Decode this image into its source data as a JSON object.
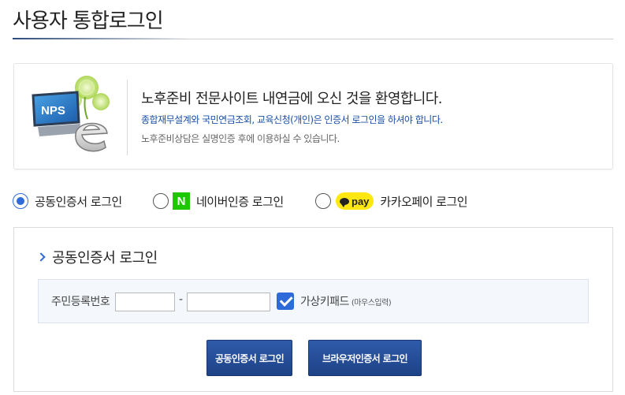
{
  "page": {
    "title": "사용자 통합로그인"
  },
  "welcome": {
    "logo_text": "NPS",
    "heading": "노후준비 전문사이트 내연금에 오신 것을 환영합니다.",
    "info": "종합재무설계와 국민연금조회, 교육신청(개인)은 인증서 로그인을 하셔야 합니다.",
    "note": "노후준비상담은 실명인증 후에 이용하실 수 있습니다."
  },
  "login_options": [
    {
      "label": "공동인증서 로그인",
      "selected": true
    },
    {
      "label": "네이버인증 로그인",
      "badge": "N",
      "selected": false
    },
    {
      "label": "카카오페이 로그인",
      "badge": "pay",
      "selected": false
    }
  ],
  "cert_login": {
    "section_title": "공동인증서 로그인",
    "rrn_label": "주민등록번호",
    "rrn_front_value": "",
    "rrn_dash": "-",
    "rrn_back_value": "",
    "virtual_keyboard_label": "가상키패드",
    "virtual_keyboard_sub": "(마우스입력)",
    "virtual_keyboard_checked": true,
    "buttons": {
      "cert_login": "공동인증서 로그인",
      "browser_cert_login": "브라우저인증서 로그인"
    }
  },
  "colors": {
    "accent": "#2f6bd8",
    "button": "#1d4287",
    "info_text": "#1a4fa3",
    "naver": "#1ec800",
    "kakao": "#ffe812"
  },
  "icons": [
    "nps-logo-icon",
    "naver-n-icon",
    "kakao-pay-icon",
    "chevron-right-icon",
    "checkbox-check-icon"
  ]
}
